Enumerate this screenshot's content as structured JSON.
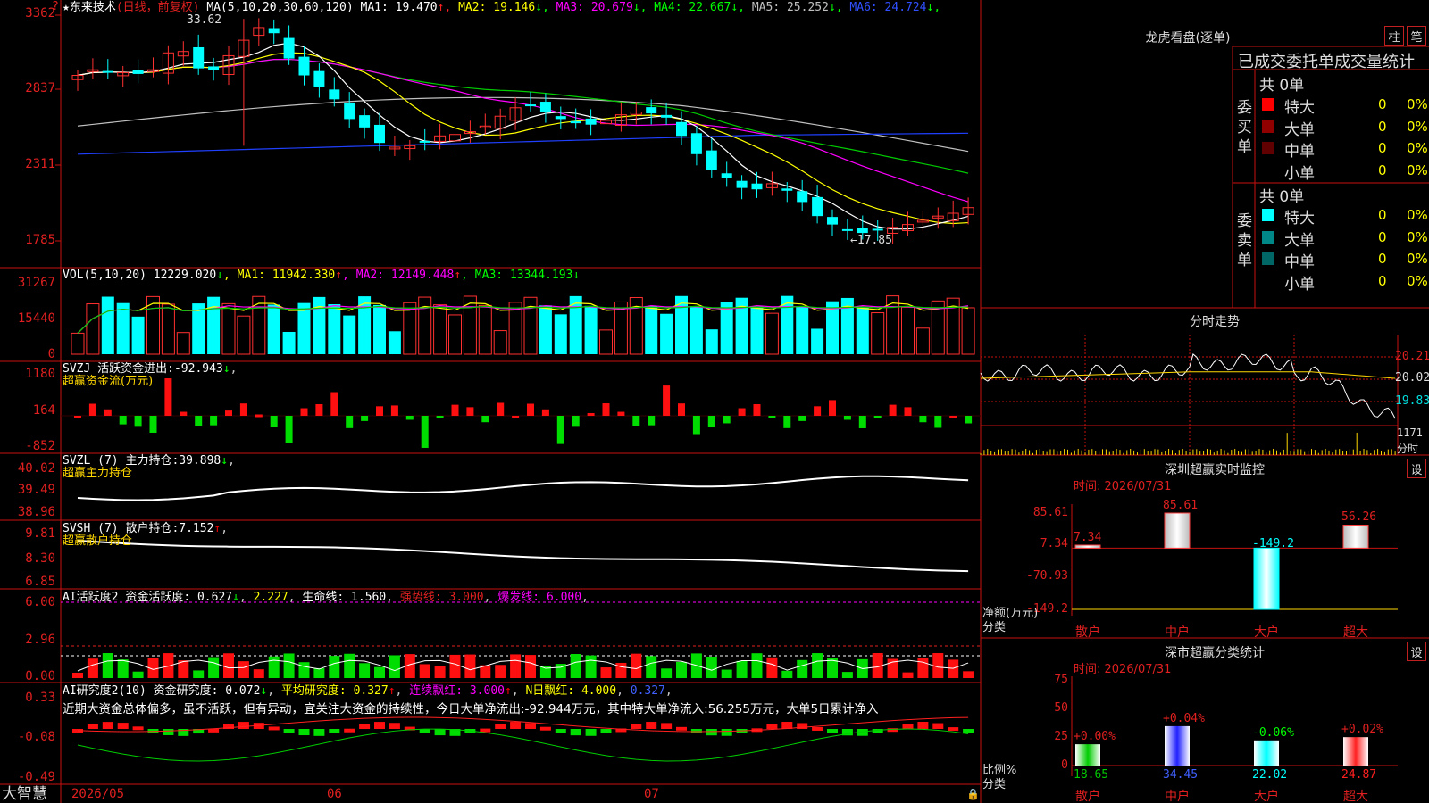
{
  "app": {
    "name": "大智慧",
    "home_icon": "lock-icon"
  },
  "header": {
    "stock_marker": "★",
    "stock_name": "东来技术",
    "mode": "(日线，前复权)",
    "ma_prefix": "MA(5,10,20,30,60,120)",
    "ma": [
      {
        "label": "MA1:",
        "value": "19.470",
        "arrow": "↑",
        "color": "#ffffff"
      },
      {
        "label": "MA2:",
        "value": "19.146",
        "arrow": "↓",
        "color": "#ffff00"
      },
      {
        "label": "MA3:",
        "value": "20.679",
        "arrow": "↓",
        "color": "#ff00ff"
      },
      {
        "label": "MA4:",
        "value": "22.667",
        "arrow": "↓",
        "color": "#00ff00"
      },
      {
        "label": "MA5:",
        "value": "25.252",
        "arrow": "↓",
        "color": "#c0c0c0"
      },
      {
        "label": "MA6:",
        "value": "24.724",
        "arrow": "↓",
        "color": "#3050ff"
      }
    ],
    "price_high": "33.62",
    "price_low": "←17.85",
    "top_icon": "question-icon"
  },
  "price_axis": [
    "3362",
    "2837",
    "2311",
    "1785"
  ],
  "vol": {
    "title": "VOL(5,10,20)",
    "value": "12229.020",
    "value_arrow": "↓",
    "ma": [
      {
        "label": "MA1:",
        "value": "11942.330",
        "arrow": "↑",
        "color": "#ffff00"
      },
      {
        "label": "MA2:",
        "value": "12149.448",
        "arrow": "↑",
        "color": "#ff00ff"
      },
      {
        "label": "MA3:",
        "value": "13344.193",
        "arrow": "↓",
        "color": "#00ff00"
      }
    ],
    "axis": [
      "31267",
      "15440",
      "0"
    ]
  },
  "svzj": {
    "title": "SVZJ",
    "label": "活跃资金进出:",
    "value": "-92.943",
    "arrow": "↓",
    "sub": "超赢资金流(万元)",
    "axis": [
      "1180",
      "164",
      "-852"
    ]
  },
  "svzl": {
    "title": "SVZL (7)",
    "label": "主力持仓:",
    "value": "39.898",
    "arrow": "↓",
    "sub": "超赢主力持仓",
    "axis": [
      "40.02",
      "39.49",
      "38.96"
    ]
  },
  "svsh": {
    "title": "SVSH (7)",
    "label": "散户持仓:",
    "value": "7.152",
    "arrow": "↑",
    "sub": "超赢散户持仓",
    "axis": [
      "9.81",
      "8.30",
      "6.85"
    ]
  },
  "ai_active": {
    "title": "AI活跃度2",
    "label": "资金活跃度:",
    "value": "0.627",
    "arrow": "↓",
    "value2": "2.227",
    "life_label": "生命线:",
    "life_value": "1.560",
    "strong_label": "强势线:",
    "strong_value": "3.000",
    "burst_label": "爆发线:",
    "burst_value": "6.000",
    "axis": [
      "6.00",
      "2.96",
      "0.00"
    ]
  },
  "ai_research": {
    "title": "AI研究度2(10)",
    "label": "资金研究度:",
    "value": "0.072",
    "arrow": "↓",
    "avg_label": "平均研究度:",
    "avg_value": "0.327",
    "avg_arrow": "↑",
    "red_label": "连续飘红:",
    "red_value": "3.000",
    "red_arrow": "↑",
    "nred_label": "N日飘红:",
    "nred_value": "4.000",
    "nred_extra": "0.327",
    "comment": "近期大资金总体偏多，虽不活跃，但有异动，宜关注大资金的持续性，今日大单净流出:-92.944万元，其中特大单净流入:56.255万元，大单5日累计净入",
    "axis": [
      "0.33",
      "-0.08",
      "-0.49"
    ]
  },
  "date_axis": [
    "2026/05",
    "06",
    "07"
  ],
  "longhu": {
    "title": "龙虎看盘(逐单)",
    "btn1": "柱",
    "btn2": "笔",
    "header": "已成交委托单成交量统计",
    "buy": {
      "side": "委买单",
      "total": "共 0单",
      "rows": [
        {
          "name": "特大",
          "count": "0",
          "pct": "0%",
          "color": "#ff0000"
        },
        {
          "name": "大单",
          "count": "0",
          "pct": "0%",
          "color": "#900000"
        },
        {
          "name": "中单",
          "count": "0",
          "pct": "0%",
          "color": "#600000"
        },
        {
          "name": "小单",
          "count": "0",
          "pct": "0%",
          "color": "#000000"
        }
      ]
    },
    "sell": {
      "side": "委卖单",
      "total": "共 0单",
      "rows": [
        {
          "name": "特大",
          "count": "0",
          "pct": "0%",
          "color": "#00ffff"
        },
        {
          "name": "大单",
          "count": "0",
          "pct": "0%",
          "color": "#008888"
        },
        {
          "name": "中单",
          "count": "0",
          "pct": "0%",
          "color": "#006666"
        },
        {
          "name": "小单",
          "count": "0",
          "pct": "0%",
          "color": "#000000"
        }
      ]
    }
  },
  "fenshi": {
    "title": "分时走势",
    "axis": [
      "20.21",
      "20.02",
      "19.83"
    ],
    "vol_label": "1171",
    "unit": "分时"
  },
  "shenzhen_monitor": {
    "title": "深圳超赢实时监控",
    "btn": "设",
    "time": "时间: 2026/07/31",
    "axis": [
      "85.61",
      "7.34",
      "-70.93",
      "-149.2"
    ],
    "unit": "净额(万元)",
    "cat_label": "分类",
    "bars": [
      {
        "name": "散户",
        "value": 7.34,
        "label": "7.34"
      },
      {
        "name": "中户",
        "value": 85.61,
        "label": "85.61"
      },
      {
        "name": "大户",
        "value": -149.2,
        "label": "-149.2"
      },
      {
        "name": "超大",
        "value": 56.26,
        "label": "56.26"
      }
    ]
  },
  "shenzhen_class": {
    "title": "深市超赢分类统计",
    "btn": "设",
    "time": "时间: 2026/07/31",
    "axis": [
      "75",
      "50",
      "25",
      "0"
    ],
    "unit": "比例%",
    "cat_label": "分类",
    "bars": [
      {
        "name": "散户",
        "value": 18.65,
        "label": "18.65",
        "change": "+0.00%",
        "color": "#00cc00"
      },
      {
        "name": "中户",
        "value": 34.45,
        "label": "34.45",
        "change": "+0.04%",
        "color": "#2020ff"
      },
      {
        "name": "大户",
        "value": 22.02,
        "label": "22.02",
        "change": "-0.06%",
        "color": "#00ffff"
      },
      {
        "name": "超大",
        "value": 24.87,
        "label": "24.87",
        "change": "+0.02%",
        "color": "#ff2020"
      }
    ]
  }
}
